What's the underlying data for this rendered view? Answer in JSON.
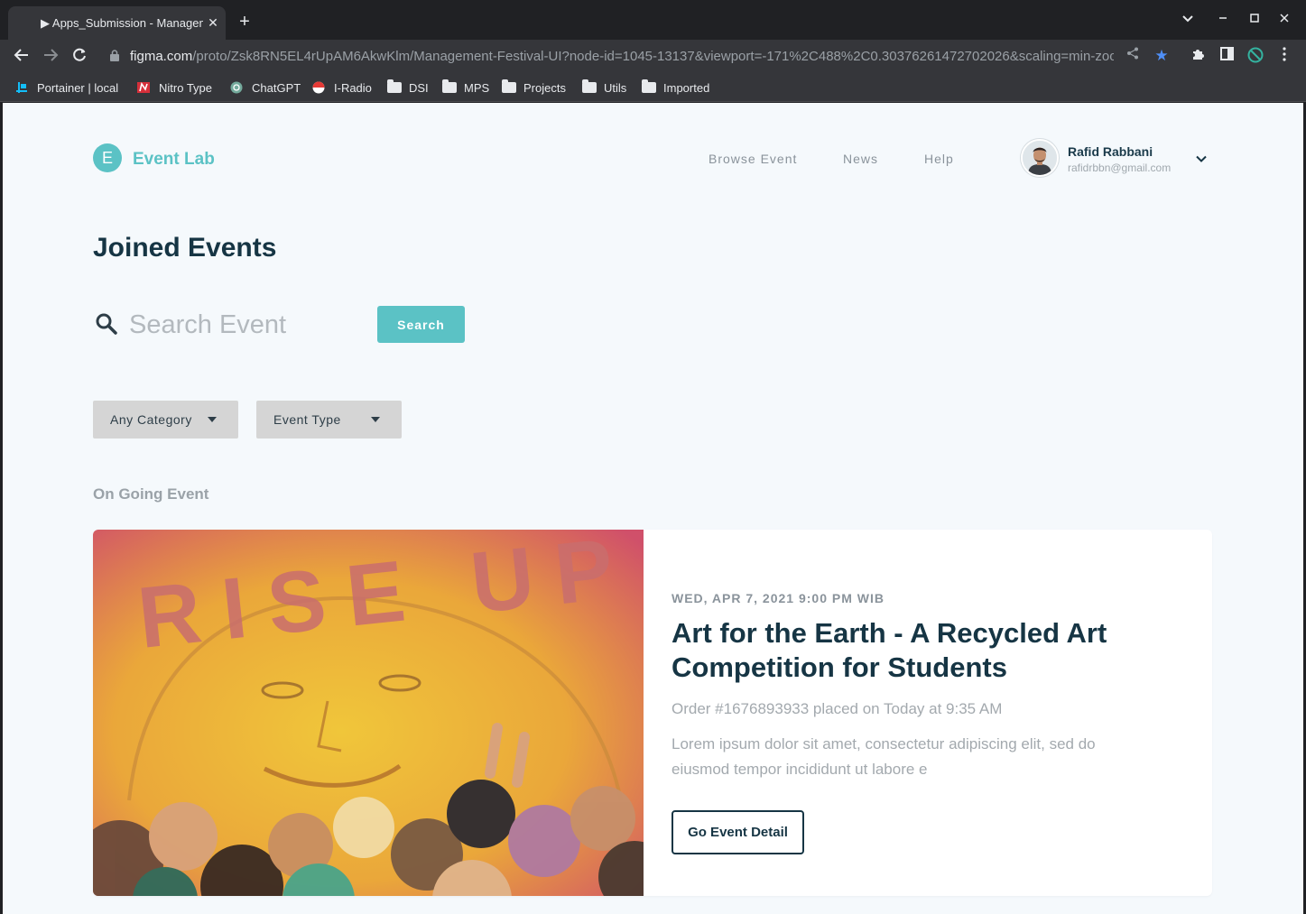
{
  "browser": {
    "tab_title": "▶ Apps_Submission - Management Festival UI",
    "close_glyph": "✕",
    "new_tab_glyph": "+",
    "url_host": "figma.com",
    "url_path": "/proto/Zsk8RN5EL4rUpAM6AkwKlm/Management-Festival-UI?node-id=1045-13137&viewport=-171%2C488%2C0.30376261472702026&scaling=min-zoo…",
    "bookmarks": [
      {
        "label": "Portainer | local",
        "icon": "portainer-icon",
        "color": "#13bef9"
      },
      {
        "label": "Nitro Type",
        "icon": "nitro-type-icon",
        "color": "#d62f3a"
      },
      {
        "label": "ChatGPT",
        "icon": "chatgpt-icon",
        "color": "#74aa9c"
      },
      {
        "label": "I-Radio",
        "icon": "i-radio-icon",
        "color": "#e53935"
      },
      {
        "label": "DSI",
        "icon": "folder-icon"
      },
      {
        "label": "MPS",
        "icon": "folder-icon"
      },
      {
        "label": "Projects",
        "icon": "folder-icon"
      },
      {
        "label": "Utils",
        "icon": "folder-icon"
      },
      {
        "label": "Imported",
        "icon": "folder-icon"
      }
    ]
  },
  "header": {
    "logo_letter": "E",
    "logo_text": "Event Lab",
    "nav": [
      "Browse Event",
      "News",
      "Help"
    ],
    "user_name": "Rafid Rabbani",
    "user_email": "rafidrbbn@gmail.com"
  },
  "page": {
    "title": "Joined Events",
    "search_placeholder": "Search Event",
    "search_button": "Search",
    "filters": [
      "Any Category",
      "Event Type"
    ],
    "section_label": "On Going Event"
  },
  "event": {
    "date": "WED, APR 7, 2021 9:00 PM WIB",
    "title": "Art for the Earth - A Recycled Art Competition for Students",
    "order": "Order #1676893933 placed on Today at 9:35 AM",
    "description": "Lorem ipsum dolor sit amet, consectetur adipiscing elit, sed do eiusmod tempor incididunt ut labore e",
    "button": "Go Event Detail",
    "image_text": "RISE UP"
  },
  "colors": {
    "accent": "#5bc2c5",
    "heading": "#163544",
    "page_bg": "#f5f9fc"
  }
}
